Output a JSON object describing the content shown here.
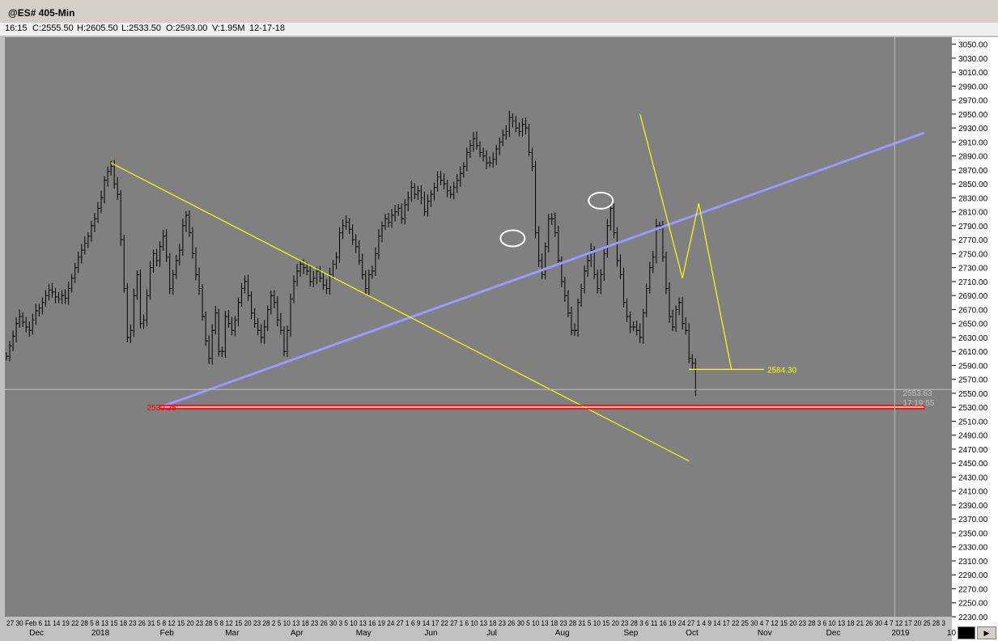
{
  "window": {
    "title": "@ES# 405-Min"
  },
  "quote": {
    "time": "16:15",
    "close": "C:2555.50",
    "high": "H:2605.50",
    "low": "L:2533.50",
    "open": "O:2593.00",
    "volume": "V:1.95M",
    "date": "12-17-18"
  },
  "colors": {
    "plot_bg": "#808080",
    "bars": "#000000",
    "trend_blue": "#9999ff",
    "trend_yellow": "#ffff00",
    "support_red": "#ff0000",
    "ellipse": "#ffffff"
  },
  "chart_data": {
    "type": "line",
    "title": "",
    "xlabel": "",
    "ylabel": "",
    "ylim": [
      2230,
      3060
    ],
    "y_ticks": [
      "3050.00",
      "3030.00",
      "3010.00",
      "2990.00",
      "2970.00",
      "2950.00",
      "2930.00",
      "2910.00",
      "2890.00",
      "2870.00",
      "2850.00",
      "2830.00",
      "2810.00",
      "2790.00",
      "2770.00",
      "2750.00",
      "2730.00",
      "2710.00",
      "2690.00",
      "2670.00",
      "2650.00",
      "2630.00",
      "2610.00",
      "2590.00",
      "2570.00",
      "2550.00",
      "2530.00",
      "2510.00",
      "2490.00",
      "2470.00",
      "2450.00",
      "2430.00",
      "2410.00",
      "2390.00",
      "2370.00",
      "2350.00",
      "2330.00",
      "2310.00",
      "2290.00",
      "2270.00",
      "2250.00",
      "2230.00"
    ],
    "x_months": [
      {
        "label": "Dec",
        "i": 7
      },
      {
        "label": "2018",
        "i": 26
      },
      {
        "label": "Feb",
        "i": 47
      },
      {
        "label": "Mar",
        "i": 67
      },
      {
        "label": "Apr",
        "i": 87
      },
      {
        "label": "May",
        "i": 107
      },
      {
        "label": "Jun",
        "i": 128
      },
      {
        "label": "Jul",
        "i": 147
      },
      {
        "label": "Aug",
        "i": 168
      },
      {
        "label": "Sep",
        "i": 189
      },
      {
        "label": "Oct",
        "i": 208
      },
      {
        "label": "Nov",
        "i": 230
      },
      {
        "label": "Dec",
        "i": 251
      },
      {
        "label": "2019",
        "i": 271
      },
      {
        "label": "10",
        "i": 288
      }
    ],
    "x_day_ticks": "27 30 Feb 6 11 14 19 22 28 5 8 13 15 18 23 26 31 5 8 12 15 20 23 28 5 8 12 15 20 23 28 2 5 10 13 18 23 26 30 3 5 10 13 16 19 24 27 1 6 9 14 17 22 27 1 6 10 13 18 23 26 30 5 10 13 18 23 28 31 5 10 15 20 23 28 3 6 11 16 19 24 27 1 4 9 14 17 22 25 30 4 7 12 15 20 23 28 3 6 10 13 18 21 26 30 4 7 12 17 20 25 28 3",
    "series": [
      {
        "name": "",
        "values": [
          2603,
          2618,
          2632,
          2650,
          2660,
          2652,
          2645,
          2640,
          2655,
          2668,
          2672,
          2680,
          2690,
          2698,
          2695,
          2688,
          2685,
          2690,
          2686,
          2700,
          2715,
          2730,
          2745,
          2755,
          2765,
          2775,
          2790,
          2800,
          2815,
          2830,
          2855,
          2868,
          2875,
          2850,
          2835,
          2770,
          2700,
          2630,
          2640,
          2690,
          2720,
          2650,
          2655,
          2690,
          2730,
          2750,
          2740,
          2760,
          2775,
          2745,
          2700,
          2720,
          2740,
          2755,
          2790,
          2805,
          2780,
          2750,
          2720,
          2700,
          2660,
          2625,
          2600,
          2640,
          2665,
          2610,
          2610,
          2660,
          2650,
          2640,
          2655,
          2680,
          2700,
          2710,
          2690,
          2665,
          2650,
          2640,
          2630,
          2645,
          2670,
          2690,
          2680,
          2655,
          2640,
          2610,
          2640,
          2685,
          2710,
          2725,
          2735,
          2730,
          2725,
          2710,
          2715,
          2725,
          2715,
          2705,
          2700,
          2720,
          2735,
          2745,
          2780,
          2790,
          2795,
          2785,
          2770,
          2760,
          2740,
          2720,
          2700,
          2720,
          2725,
          2750,
          2775,
          2790,
          2800,
          2795,
          2805,
          2810,
          2815,
          2800,
          2820,
          2830,
          2845,
          2835,
          2840,
          2830,
          2810,
          2825,
          2835,
          2845,
          2860,
          2855,
          2850,
          2840,
          2835,
          2845,
          2855,
          2865,
          2875,
          2895,
          2905,
          2915,
          2905,
          2895,
          2890,
          2880,
          2880,
          2885,
          2900,
          2910,
          2920,
          2925,
          2945,
          2940,
          2930,
          2925,
          2935,
          2930,
          2895,
          2875,
          2780,
          2740,
          2720,
          2760,
          2800,
          2800,
          2780,
          2740,
          2710,
          2690,
          2665,
          2640,
          2640,
          2680,
          2700,
          2725,
          2740,
          2755,
          2720,
          2700,
          2720,
          2750,
          2790,
          2815,
          2780,
          2740,
          2720,
          2680,
          2660,
          2645,
          2645,
          2640,
          2630,
          2665,
          2700,
          2730,
          2745,
          2790,
          2790,
          2745,
          2700,
          2660,
          2645,
          2670,
          2680,
          2650,
          2640,
          2600,
          2593,
          2555
        ]
      }
    ],
    "annotations": [
      {
        "text": "2530.25",
        "value": 2530.25,
        "color": "red"
      },
      {
        "text": "2584.30",
        "value": 2584.3,
        "color": "yellow"
      },
      {
        "text": "2555.50",
        "value": 2555.5,
        "note": "last price"
      },
      {
        "text": "2553.63",
        "value": 2553.63
      },
      {
        "text": "17:19:55"
      }
    ],
    "trend_lines": [
      {
        "name": "blue-uptrend",
        "from": {
          "i": 47,
          "v": 2530
        },
        "to": {
          "i": 281,
          "v": 2923
        }
      },
      {
        "name": "yellow-downtrend",
        "from": {
          "i": 32,
          "v": 2880
        },
        "to": {
          "i": 209,
          "v": 2453
        }
      },
      {
        "name": "red-support",
        "from": {
          "i": 47,
          "v": 2530.25
        },
        "to": {
          "i": 281,
          "v": 2530.25
        }
      },
      {
        "name": "yellow-zigzag",
        "points": [
          {
            "i": 194,
            "v": 2950
          },
          {
            "i": 207,
            "v": 2715
          },
          {
            "i": 212,
            "v": 2822
          },
          {
            "i": 222,
            "v": 2584.3
          }
        ]
      },
      {
        "name": "yellow-target",
        "from": {
          "i": 209,
          "v": 2584.3
        },
        "to": {
          "i": 232,
          "v": 2584.3
        }
      }
    ]
  }
}
